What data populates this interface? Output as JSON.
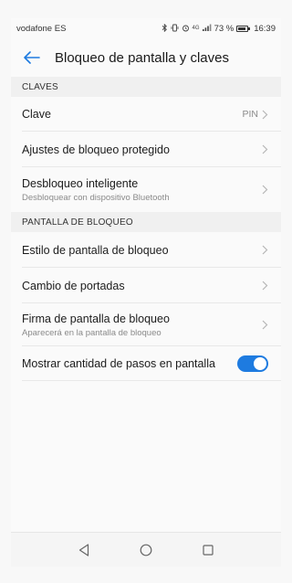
{
  "status_bar": {
    "carrier": "vodafone ES",
    "battery_percent": "73 %",
    "time": "16:39",
    "signal_label": "4G",
    "icons": [
      "bluetooth-icon",
      "vibrate-icon",
      "alarm-icon",
      "signal-icon",
      "battery-icon"
    ]
  },
  "app_bar": {
    "title": "Bloqueo de pantalla y claves",
    "back_icon": "arrow-left-icon"
  },
  "sections": {
    "claves": {
      "header": "CLAVES",
      "items": [
        {
          "title": "Clave",
          "value": "PIN"
        },
        {
          "title": "Ajustes de bloqueo protegido"
        },
        {
          "title": "Desbloqueo inteligente",
          "subtitle": "Desbloquear con dispositivo Bluetooth"
        }
      ]
    },
    "pantalla": {
      "header": "PANTALLA DE BLOQUEO",
      "items": [
        {
          "title": "Estilo de pantalla de bloqueo"
        },
        {
          "title": "Cambio de portadas"
        },
        {
          "title": "Firma de pantalla de bloqueo",
          "subtitle": "Aparecerá en la pantalla de bloqueo"
        },
        {
          "title": "Mostrar cantidad de pasos en pantalla",
          "toggle_on": true
        }
      ]
    }
  },
  "colors": {
    "accent": "#1e7be0",
    "section_bg": "#f0f0f0",
    "background": "#fafafa"
  },
  "nav_bar": {
    "icons": [
      "back-triangle-icon",
      "home-circle-icon",
      "recents-square-icon"
    ]
  }
}
